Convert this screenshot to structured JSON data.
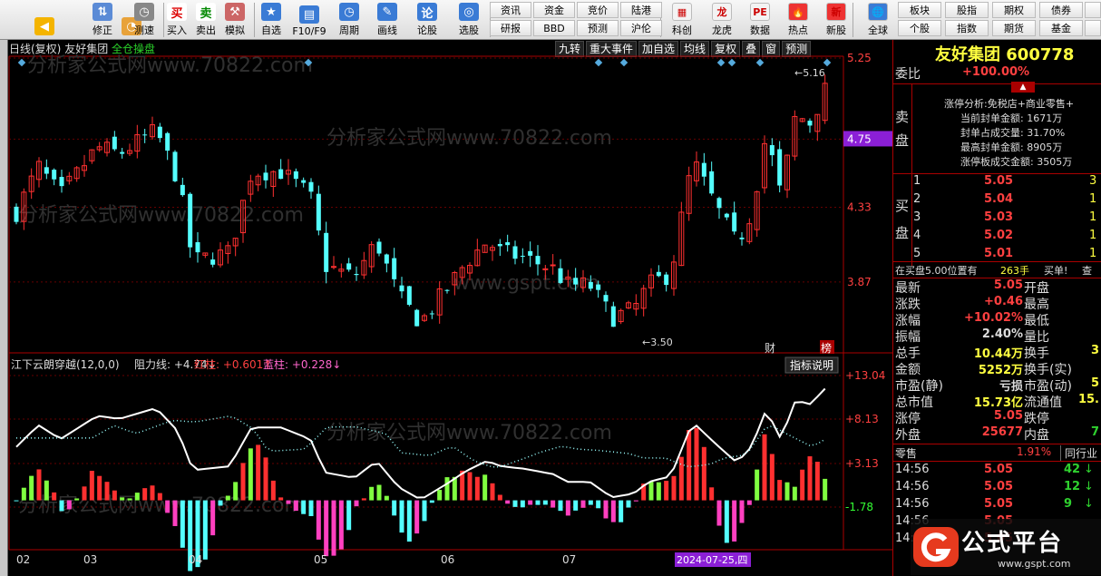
{
  "toolbar": {
    "items": [
      {
        "label": "",
        "icon": "back-arrow-icon"
      },
      {
        "label": "修正",
        "icon": "up-down-icon"
      },
      {
        "label": "",
        "icon": "cup-icon"
      },
      {
        "label": "测速",
        "icon": "clock-icon"
      },
      {
        "label": "买入",
        "icon": "buy-icon",
        "glyph": "买"
      },
      {
        "label": "卖出",
        "icon": "sell-icon",
        "glyph": "卖"
      },
      {
        "label": "模拟",
        "icon": "hammer-icon"
      },
      {
        "label": "自选",
        "icon": "star-icon"
      },
      {
        "label": "F10/F9",
        "icon": "f10-icon"
      },
      {
        "label": "周期",
        "icon": "period-icon"
      },
      {
        "label": "画线",
        "icon": "pencil-icon"
      },
      {
        "label": "论股",
        "icon": "discuss-icon"
      },
      {
        "label": "选股",
        "icon": "search-icon"
      }
    ],
    "minis": [
      "资讯",
      "资金",
      "竞价",
      "陆港",
      "研报",
      "BBD",
      "预测",
      "沪伦"
    ],
    "items2": [
      {
        "label": "科创",
        "icon": "kechuang-icon"
      },
      {
        "label": "龙虎",
        "icon": "dragon-icon"
      },
      {
        "label": "数据",
        "icon": "data-icon"
      },
      {
        "label": "热点",
        "icon": "hot-icon"
      },
      {
        "label": "新股",
        "icon": "new-stock-icon"
      },
      {
        "label": "全球",
        "icon": "globe-icon"
      }
    ],
    "minis2": [
      "板块",
      "股指",
      "期权",
      "债券",
      "个股",
      "指数",
      "期货",
      "基金"
    ]
  },
  "chart": {
    "period": "日线(复权)",
    "name": "友好集团",
    "mode": "全仓操盘",
    "menu": [
      "九转",
      "重大事件",
      "加自选",
      "均线",
      "复权",
      "叠",
      "窗",
      "预测"
    ],
    "price_ticks": [
      "5.25",
      "4.75",
      "4.33",
      "3.87"
    ],
    "current_price_tag": "4.75",
    "high_label": "5.16",
    "low_label": "3.50",
    "marker_cai": "财",
    "marker_bang": "榜",
    "watermark1": "分析家公式网www.70822.com",
    "watermark2": "www.gspt.com",
    "indicator": {
      "name": "江下云朗穿越(12,0,0)",
      "resist": "阻力线: +4.74↓",
      "red": "红柱: +0.601↑",
      "blue": "蓝柱: +0.228↓",
      "help": "指标说明",
      "ticks": [
        "+13.04",
        "+8.13",
        "+3.13",
        "-1.78"
      ]
    },
    "months": [
      "02",
      "03",
      "04",
      "05",
      "06",
      "07"
    ],
    "date_tag": "2024-07-25,四"
  },
  "quote": {
    "title": "友好集团 600778",
    "weibi_label": "委比",
    "weibi_value": "+100.00%",
    "sell_label": "卖盘",
    "buy_label": "买盘",
    "limit_info": [
      "涨停分析:免税店+商业零售+",
      "当前封单金额: 1671万",
      "封单占成交量: 31.70%",
      "最高封单金额: 8905万",
      "涨停板成交金额: 3505万"
    ],
    "bids": [
      {
        "n": "1",
        "p": "5.05",
        "v": "3"
      },
      {
        "n": "2",
        "p": "5.04",
        "v": "1"
      },
      {
        "n": "3",
        "p": "5.03",
        "v": "1"
      },
      {
        "n": "4",
        "p": "5.02",
        "v": "1"
      },
      {
        "n": "5",
        "p": "5.01",
        "v": "1"
      }
    ],
    "queue": [
      "在买盘5.00位置有",
      "263手",
      "买单!",
      "查"
    ],
    "stats": [
      [
        "最新",
        "5.05",
        "开盘",
        ""
      ],
      [
        "涨跌",
        "+0.46",
        "最高",
        ""
      ],
      [
        "涨幅",
        "+10.02%",
        "最低",
        ""
      ],
      [
        "振幅",
        "2.40%",
        "量比",
        ""
      ],
      [
        "总手",
        "10.44万",
        "换手",
        "3"
      ],
      [
        "金额",
        "5252万",
        "换手(实)",
        ""
      ],
      [
        "市盈(静)",
        "亏损",
        "市盈(动)",
        "5"
      ],
      [
        "总市值",
        "15.73亿",
        "流通值",
        "15."
      ],
      [
        "涨停",
        "5.05",
        "跌停",
        ""
      ],
      [
        "外盘",
        "25677",
        "内盘",
        "7"
      ]
    ],
    "sector": [
      "零售",
      "1.91%",
      "同行业"
    ],
    "ticks": [
      [
        "14:56",
        "5.05",
        "42"
      ],
      [
        "14:56",
        "5.05",
        "12"
      ],
      [
        "14:56",
        "5.05",
        "9"
      ],
      [
        "14:56",
        "5.05",
        ""
      ],
      [
        "14:56",
        "5.05",
        ""
      ]
    ],
    "logo_text": "公式平台",
    "logo_url": "www.gspt.com"
  },
  "chart_data": {
    "type": "candlestick",
    "title": "",
    "x_range": [
      "2024-02",
      "2024-07-25"
    ],
    "ylim": [
      3.5,
      5.25
    ],
    "y_ticks": [
      3.87,
      4.33,
      4.75,
      5.25
    ],
    "last_close": 5.05,
    "high": 5.16,
    "low": 3.5,
    "indicator_ylim": [
      -1.78,
      13.04
    ]
  }
}
